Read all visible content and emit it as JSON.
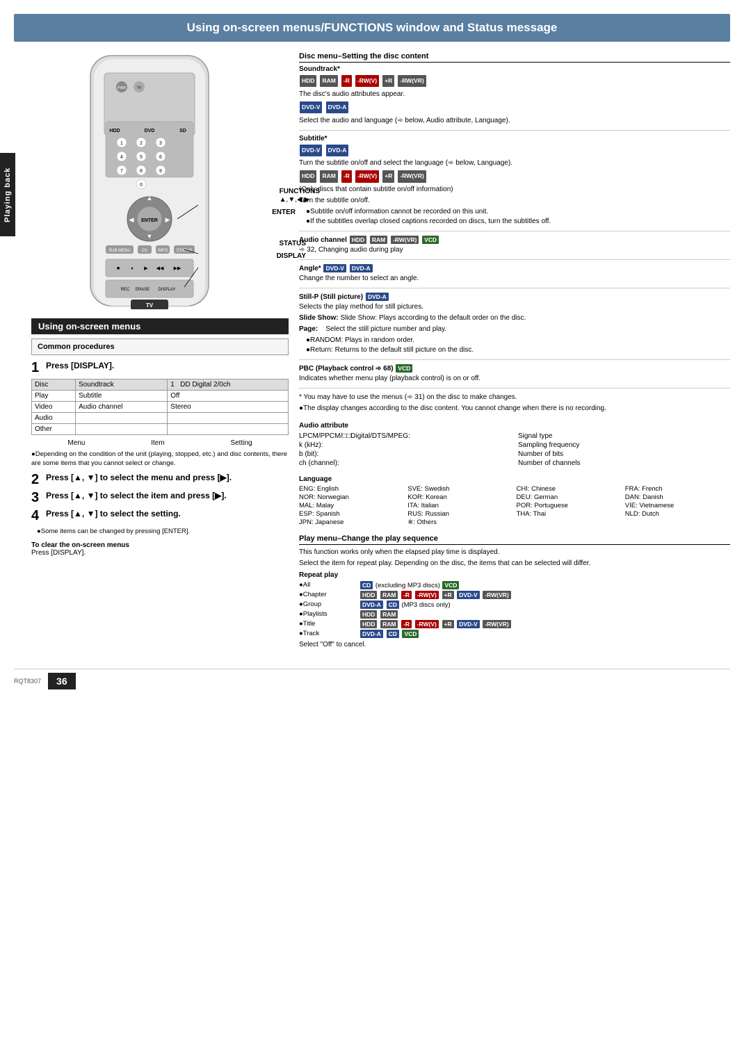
{
  "page": {
    "title": "Using on-screen menus/FUNCTIONS window and Status message",
    "footer_code": "RQT8307",
    "page_number": "36"
  },
  "playing_back_tab": "Playing back",
  "left": {
    "section_title": "Using on-screen menus",
    "common_procedures_label": "Common procedures",
    "steps": [
      {
        "num": "1",
        "text": "Press [DISPLAY]."
      },
      {
        "num": "2",
        "text": "Press [▲, ▼] to select the menu and press [▶]."
      },
      {
        "num": "3",
        "text": "Press [▲, ▼] to select the item and press [▶]."
      },
      {
        "num": "4",
        "text": "Press [▲, ▼] to select the setting."
      }
    ],
    "step4_note": "●Some items can be changed by pressing [ENTER].",
    "menu_table": {
      "headers": [
        "Menu",
        "Item",
        "Setting"
      ],
      "rows": [
        [
          "Disc",
          "Soundtrack",
          "1    DD Digital  2/0ch"
        ],
        [
          "Play",
          "Subtitle",
          "Off"
        ],
        [
          "Video",
          "Audio channel",
          "Stereo"
        ],
        [
          "Audio",
          "",
          ""
        ],
        [
          "Other",
          "",
          ""
        ]
      ]
    },
    "note1": "●Depending on the condition of the unit (playing, stopped, etc.) and disc contents, there are some items that you cannot select or change.",
    "to_clear_title": "To clear the on-screen menus",
    "to_clear_text": "Press [DISPLAY].",
    "annotations": {
      "functions": "FUNCTIONS",
      "functions_sub": "▲,▼,◀,▶",
      "enter": "ENTER",
      "status": "STATUS",
      "display": "DISPLAY"
    }
  },
  "right": {
    "disc_menu_section": {
      "title": "Disc menu–Setting the disc content",
      "soundtrack": {
        "label": "Soundtrack*",
        "badges_line1": [
          "HDD",
          "RAM",
          "-R",
          "-RW(V)",
          "+R",
          "-RW(VR)"
        ],
        "desc1": "The disc's audio attributes appear.",
        "badges_line2": [
          "DVD-V",
          "DVD-A"
        ],
        "desc2": "Select the audio and language (➾ below, Audio attribute, Language)."
      },
      "subtitle": {
        "label": "Subtitle*",
        "badges_line1": [
          "DVD-V",
          "DVD-A"
        ],
        "desc1": "Turn the subtitle on/off and select the language (➾ below, Language).",
        "badges_line2": [
          "HDD",
          "RAM",
          "-R",
          "-RW(V)",
          "+R",
          "-RW(VR)"
        ],
        "desc2": "(Only discs that contain subtitle on/off information)",
        "desc3": "Turn the subtitle on/off.",
        "bullets": [
          "●Subtitle on/off information cannot be recorded on this unit.",
          "●If the subtitles overlap closed captions recorded on discs, turn the subtitles off."
        ]
      },
      "audio_channel": {
        "label": "Audio channel",
        "badges": [
          "HDD",
          "RAM",
          "-RW(VR)",
          "VCD"
        ],
        "desc": "➾ 32, Changing audio during play"
      },
      "angle": {
        "label": "Angle*",
        "badges": [
          "DVD-V",
          "DVD-A"
        ],
        "desc": "Change the number to select an angle."
      },
      "still_p": {
        "label": "Still-P (Still picture)",
        "badges": [
          "DVD-A"
        ],
        "desc": "Selects the play method for still pictures.",
        "slide_show": "Slide Show: Plays according to the default order on the disc.",
        "page_label": "Page:",
        "page_desc": "Select the still picture number and play.",
        "bullets": [
          "●RANDOM: Plays in random order.",
          "●Return:    Returns to the default still picture on the disc."
        ]
      },
      "pbc": {
        "label": "PBC (Playback control ➾ 68)",
        "badges": [
          "VCD"
        ],
        "desc": "Indicates whether menu play (playback control) is on or off."
      },
      "footnotes": [
        "* You may have to use the menus (➾ 31) on the disc to make changes.",
        "●The display changes according to the disc content. You cannot change when there is no recording."
      ]
    },
    "audio_attribute": {
      "title": "Audio attribute",
      "rows": [
        [
          "LPCM/PPCM/□□Digital/DTS/MPEG:",
          "Signal type"
        ],
        [
          "k (kHz):",
          "Sampling frequency"
        ],
        [
          "b (bit):",
          "Number of bits"
        ],
        [
          "ch (channel):",
          "Number of channels"
        ]
      ]
    },
    "language": {
      "title": "Language",
      "entries": [
        "ENG: English",
        "SVE: Swedish",
        "CHI: Chinese",
        "FRA: French",
        "NOR: Norwegian",
        "KOR: Korean",
        "DEU: German",
        "DAN: Danish",
        "MAL: Malay",
        "ITA: Italian",
        "POR: Portuguese",
        "VIE: Vietnamese",
        "ESP: Spanish",
        "RUS: Russian",
        "THA: Thai",
        "NLD: Dutch",
        "JPN: Japanese",
        "※:   Others"
      ]
    },
    "play_menu": {
      "title": "Play menu–Change the play sequence",
      "desc1": "This function works only when the elapsed play time is displayed.",
      "desc2": "Select the item for repeat play. Depending on the disc, the items that can be selected will differ.",
      "repeat_play_label": "Repeat play",
      "repeat_items": [
        {
          "bullet": "●All",
          "badges": [
            "CD"
          ],
          "extra": "(excluding MP3 discs)",
          "extra_badges": [
            "VCD"
          ]
        },
        {
          "bullet": "●Chapter",
          "badges": [
            "HDD",
            "RAM",
            "-R",
            "-RW(V)",
            "+R",
            "DVD-V",
            "-RW(VR)"
          ]
        },
        {
          "bullet": "●Group",
          "badges": [
            "DVD-A",
            "CD"
          ],
          "extra": "(MP3 discs only)"
        },
        {
          "bullet": "●Playlists",
          "badges": [
            "HDD",
            "RAM"
          ]
        },
        {
          "bullet": "●Title",
          "badges": [
            "HDD",
            "RAM",
            "-R",
            "-RW(V)",
            "+R",
            "DVD-V",
            "-RW(VR)"
          ]
        },
        {
          "bullet": "●Track",
          "badges": [
            "DVD-A",
            "CD",
            "VCD"
          ]
        }
      ],
      "select_off": "Select \"Off\" to cancel."
    }
  }
}
